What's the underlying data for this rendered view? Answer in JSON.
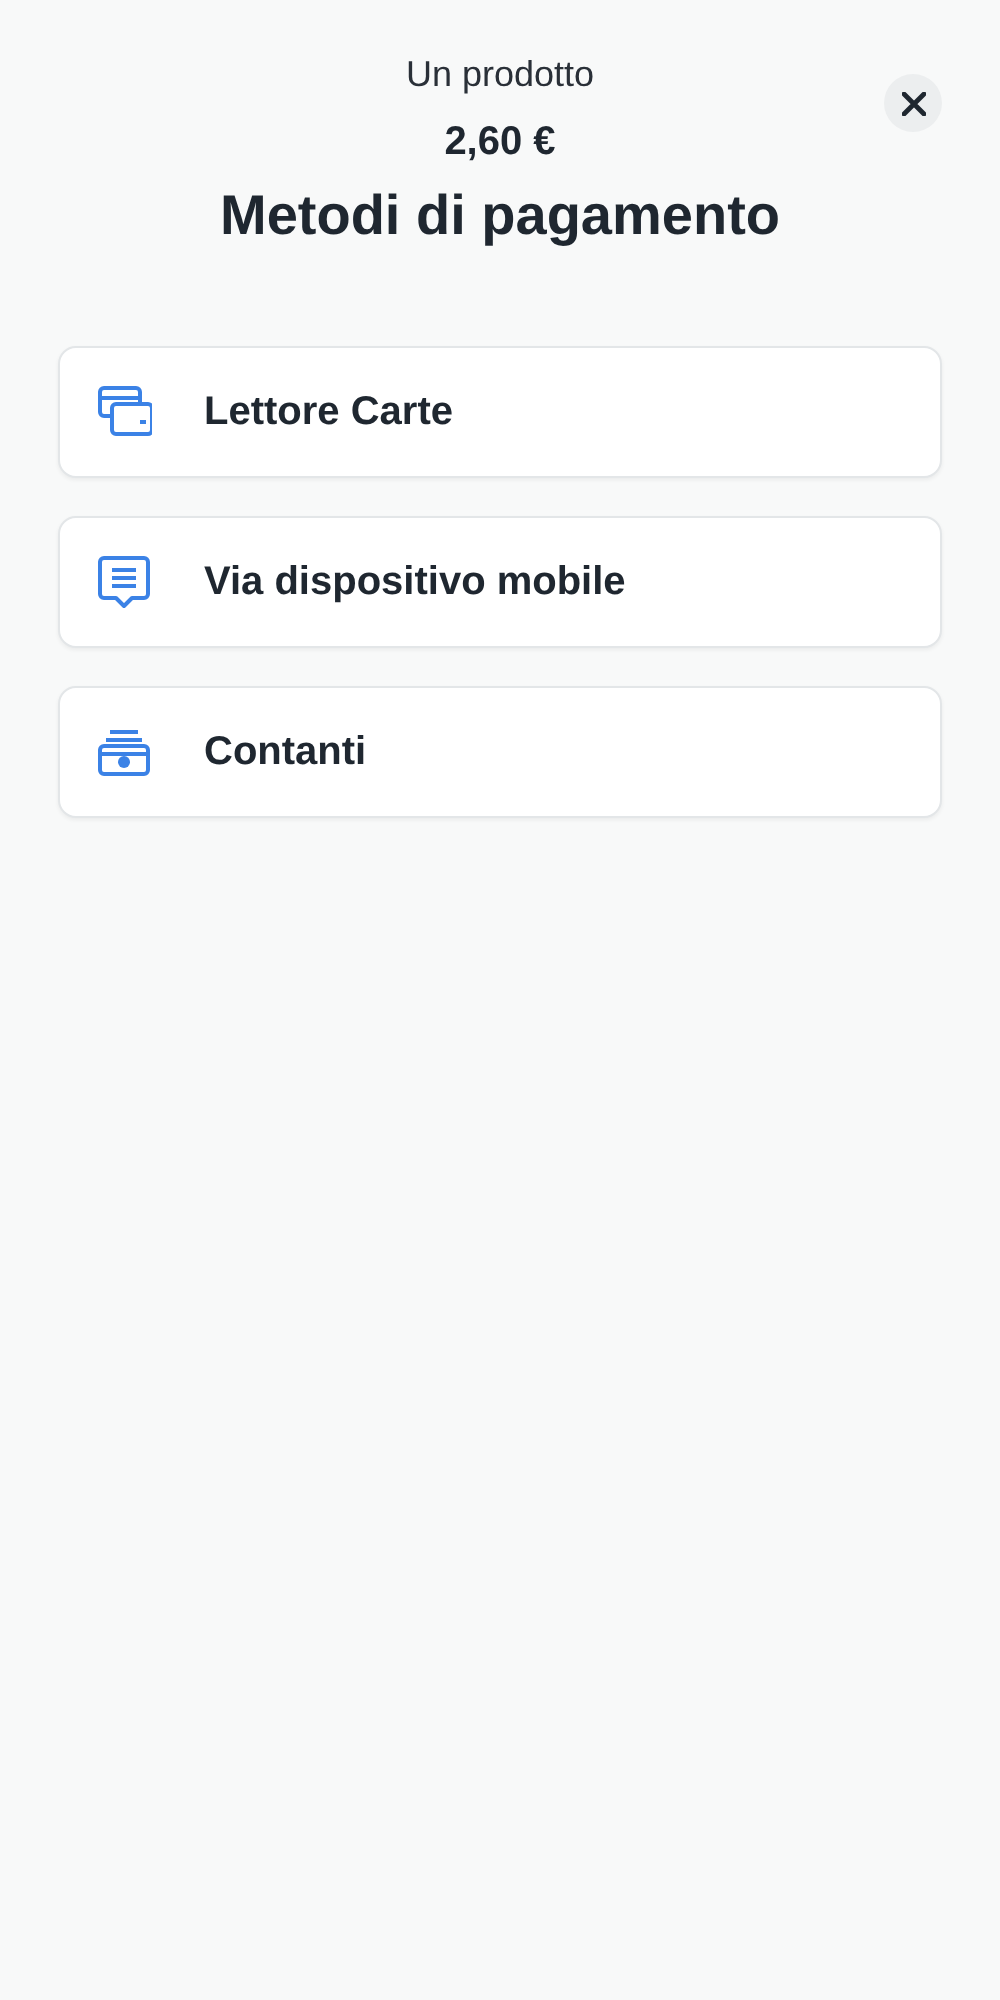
{
  "header": {
    "subtitle": "Un prodotto",
    "amount": "2,60 €",
    "title": "Metodi di pagamento"
  },
  "methods": [
    {
      "kind": "card",
      "label": "Lettore Carte"
    },
    {
      "kind": "message",
      "label": "Via dispositivo mobile"
    },
    {
      "kind": "cash",
      "label": "Contanti"
    }
  ]
}
